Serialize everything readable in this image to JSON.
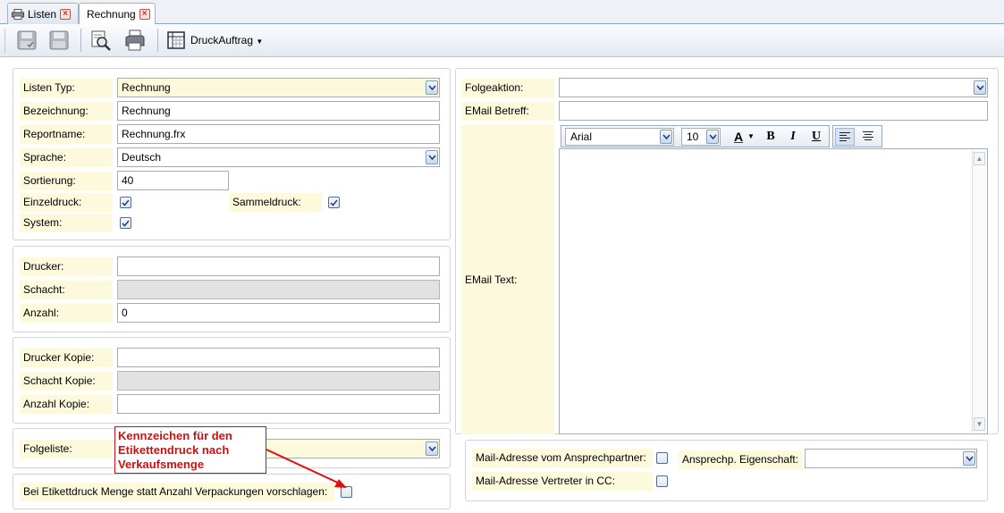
{
  "tabs": [
    {
      "label": "Listen",
      "icon": "printer-icon"
    },
    {
      "label": "Rechnung",
      "icon": "none"
    }
  ],
  "toolbar": {
    "druck_label": "DruckAuftrag",
    "buttons": [
      "save-close-icon",
      "save-icon",
      "print-preview-icon",
      "print-icon",
      "grid-icon"
    ]
  },
  "left": {
    "listen_typ": {
      "label": "Listen Typ:",
      "value": "Rechnung"
    },
    "bezeichnung": {
      "label": "Bezeichnung:",
      "value": "Rechnung"
    },
    "reportname": {
      "label": "Reportname:",
      "value": "Rechnung.frx"
    },
    "sprache": {
      "label": "Sprache:",
      "value": "Deutsch"
    },
    "sortierung": {
      "label": "Sortierung:",
      "value": "40"
    },
    "einzeldruck": {
      "label": "Einzeldruck:",
      "checked": true
    },
    "sammeldruck": {
      "label": "Sammeldruck:",
      "checked": true
    },
    "system": {
      "label": "System:",
      "checked": true
    },
    "drucker": {
      "label": "Drucker:",
      "value": ""
    },
    "schacht": {
      "label": "Schacht:",
      "value": ""
    },
    "anzahl": {
      "label": "Anzahl:",
      "value": "0"
    },
    "drucker_kopie": {
      "label": "Drucker Kopie:",
      "value": ""
    },
    "schacht_kopie": {
      "label": "Schacht Kopie:",
      "value": ""
    },
    "anzahl_kopie": {
      "label": "Anzahl Kopie:",
      "value": ""
    },
    "folgeliste": {
      "label": "Folgeliste:",
      "value": ""
    },
    "etikett": {
      "label": "Bei Etikettdruck Menge statt Anzahl Verpackungen vorschlagen:",
      "checked": false
    }
  },
  "annotation": {
    "text": "Kennzeichen für den Etikettendruck nach Verkaufsmenge",
    "color": "#d01010"
  },
  "right": {
    "folgeaktion": {
      "label": "Folgeaktion:",
      "value": ""
    },
    "email_betreff": {
      "label": "EMail Betreff:",
      "value": ""
    },
    "email_text": {
      "label": "EMail Text:"
    },
    "editor": {
      "font": "Arial",
      "size": "10",
      "bold": "B",
      "italic": "I",
      "underline": "U",
      "font_color_letter": "A"
    },
    "mail_ansprechpartner": {
      "label": "Mail-Adresse vom Ansprechpartner:",
      "checked": false
    },
    "mail_vertreter_cc": {
      "label": "Mail-Adresse Vertreter in CC:",
      "checked": false
    },
    "ansprech_eigenschaft": {
      "label": "Ansprechp. Eigenschaft:",
      "value": ""
    }
  },
  "colors": {
    "label_bg": "#fcf9dd",
    "accent_blue": "#8ba6c9",
    "callout_red": "#cc1111"
  }
}
